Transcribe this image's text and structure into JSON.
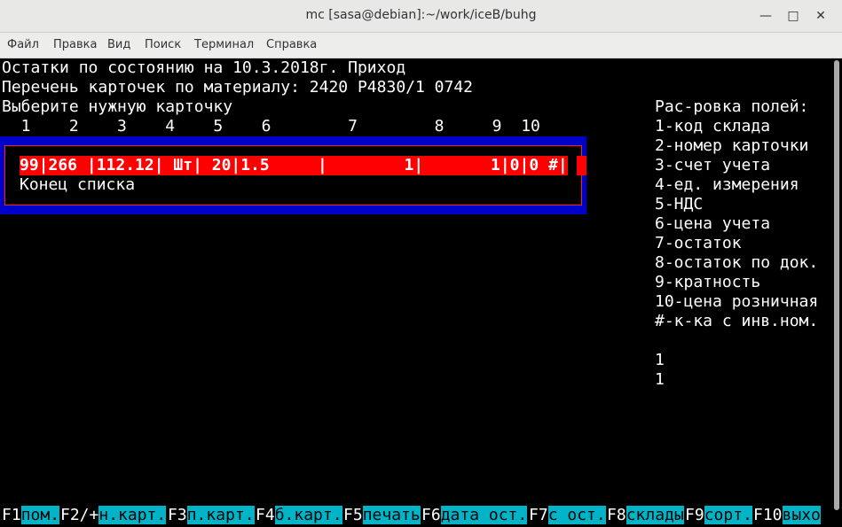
{
  "window": {
    "title": "mc [sasa@debian]:~/work/iceB/buhg"
  },
  "menu": [
    "Файл",
    "Правка",
    "Вид",
    "Поиск",
    "Терминал",
    "Справка"
  ],
  "header": {
    "line1": "Остатки по состоянию на 10.3.2018г. Приход",
    "line2": "Перечень карточек по материалу: 2420 Р4830/1 0742",
    "line3": "Выберите нужную карточку",
    "columns": "  1    2    3    4    5    6        7        8     9  10"
  },
  "list": {
    "selected_row": "99|266 |112.12| Шт| 20|1.5     |        1|       1|0|0 #|",
    "end_text": "Конец списка"
  },
  "legend": {
    "title": "Рас-ровка полей:",
    "items": [
      "1-код склада",
      "2-номер карточки",
      "3-счет учета",
      "4-ед. измерения",
      "5-НДС",
      "6-цена учета",
      "7-остаток",
      "8-остаток по док.",
      "9-кратность",
      "10-цена розничная",
      "#-к-ка с инв.ном."
    ],
    "values": [
      "1",
      "1"
    ]
  },
  "fkeys": [
    {
      "key": "F1",
      "label": "пом."
    },
    {
      "key": "F2/+",
      "label": "н.карт."
    },
    {
      "key": "F3",
      "label": "п.карт."
    },
    {
      "key": "F4",
      "label": "б.карт."
    },
    {
      "key": "F5",
      "label": "печать"
    },
    {
      "key": "F6",
      "label": "дата ост."
    },
    {
      "key": "F7",
      "label": "с ост."
    },
    {
      "key": "F8",
      "label": "склады"
    },
    {
      "key": "F9",
      "label": "сорт."
    },
    {
      "key": "F10",
      "label": "выхо"
    }
  ]
}
